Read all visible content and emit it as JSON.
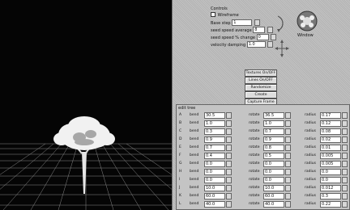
{
  "controls": {
    "group_title": "Controls",
    "wireframe_label": "Wireframe",
    "base_step_label": "Base step",
    "base_step_value": "1",
    "seed_speed_label": "seed speed average",
    "seed_speed_value": "8",
    "seed_speed_change_label": "seed speed % change",
    "seed_speed_change_value": "0",
    "velocity_damping_label": "velocity damping",
    "velocity_damping_value": "1.0",
    "window_label": "Window"
  },
  "buttons": {
    "textures_label": "Textures On/OFF",
    "lines_label": "Lines On/OFF",
    "randomize_label": "Randomize",
    "create_label": "Create",
    "capture_label": "Capture Frame"
  },
  "edit_tree": {
    "title": "edit tree",
    "rows": [
      {
        "label": "A",
        "bend": "30.5",
        "rotate": "36.5",
        "radius": "0.17"
      },
      {
        "label": "B",
        "bend": "1.0",
        "rotate": "1.0",
        "radius": "0.12"
      },
      {
        "label": "C",
        "bend": "0.3",
        "rotate": "0.7",
        "radius": "0.08"
      },
      {
        "label": "D",
        "bend": "0.9",
        "rotate": "0.9",
        "radius": "0.02"
      },
      {
        "label": "E",
        "bend": "0.7",
        "rotate": "0.8",
        "radius": "0.01"
      },
      {
        "label": "F",
        "bend": "0.4",
        "rotate": "0.5",
        "radius": "0.005"
      },
      {
        "label": "G",
        "bend": "0.0",
        "rotate": "0.0",
        "radius": "0.005"
      },
      {
        "label": "H",
        "bend": "0.0",
        "rotate": "0.0",
        "radius": "0.0"
      },
      {
        "label": "I",
        "bend": "0.0",
        "rotate": "0.0",
        "radius": "0.0"
      },
      {
        "label": "J",
        "bend": "10.0",
        "rotate": "10.0",
        "radius": "0.012"
      },
      {
        "label": "K",
        "bend": "60.0",
        "rotate": "60.0",
        "radius": "0.3"
      },
      {
        "label": "L",
        "bend": "40.0",
        "rotate": "40.0",
        "radius": "0.22"
      }
    ],
    "bend_label": "bend",
    "rotate_label": "rotate",
    "radius_label": "radius"
  }
}
